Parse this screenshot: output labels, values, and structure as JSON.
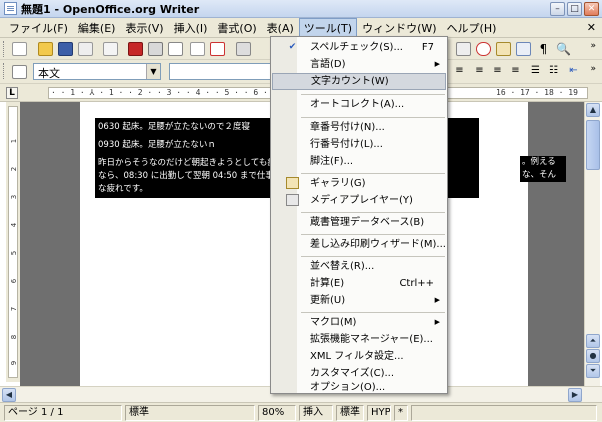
{
  "window": {
    "title": "無題1 - OpenOffice.org Writer"
  },
  "menubar": {
    "items": [
      "ファイル(F)",
      "編集(E)",
      "表示(V)",
      "挿入(I)",
      "書式(O)",
      "表(A)",
      "ツール(T)",
      "ウィンドウ(W)",
      "ヘルプ(H)"
    ],
    "active_index": 6
  },
  "formatting": {
    "paragraph_style": "本文",
    "font_name": ""
  },
  "ruler": {
    "marks": "· · 1 · ⅄ · 1 · · 2 · · 3 · · 4 · · 5 · · 6 · · 7 ·",
    "tail": "16 · 17 · 18 · 19"
  },
  "document": {
    "lines": [
      "0630 起床。足腰が立たないので２度寝",
      "0930 起床。足腰が立たないｎ",
      "昨日からそうなのだけど朝起きようとしても疲",
      "なら、08:30 に出勤して翌朝 04:50 まで仕事",
      "な疲れです。"
    ],
    "trail_1": "。例える",
    "trail_2": "な、そん"
  },
  "tools_menu": {
    "items": [
      {
        "label": "スペルチェック(S)...",
        "shortcut": "F7",
        "icon": "spellcheck-icon"
      },
      {
        "label": "言語(D)",
        "submenu": true
      },
      {
        "label": "文字カウント(W)",
        "highlighted": true
      },
      {
        "label": "オートコレクト(A)..."
      },
      {
        "label": "章番号付け(N)..."
      },
      {
        "label": "行番号付け(L)..."
      },
      {
        "label": "脚注(F)..."
      },
      {
        "label": "ギャラリ(G)",
        "icon": "gallery-icon"
      },
      {
        "label": "メディアプレイヤー(Y)",
        "icon": "media-player-icon"
      },
      {
        "label": "蔵書管理データベース(B)"
      },
      {
        "label": "差し込み印刷ウィザード(M)..."
      },
      {
        "label": "並べ替え(R)..."
      },
      {
        "label": "計算(E)",
        "shortcut": "Ctrl++"
      },
      {
        "label": "更新(U)",
        "submenu": true
      },
      {
        "label": "マクロ(M)",
        "submenu": true
      },
      {
        "label": "拡張機能マネージャー(E)..."
      },
      {
        "label": "XML フィルタ設定..."
      },
      {
        "label": "カスタマイズ(C)..."
      },
      {
        "label": "オプション(O)..."
      }
    ]
  },
  "statusbar": {
    "page": "ページ 1 / 1",
    "style": "標準",
    "zoom": "80%",
    "insert_mode": "挿入",
    "selection_mode": "標準",
    "hyphenation": "HYP",
    "modified": "*"
  },
  "colors": {
    "accent": "#c2d5ec",
    "menu_highlight": "#d4d8de",
    "doc_background": "#6f6f6f"
  }
}
